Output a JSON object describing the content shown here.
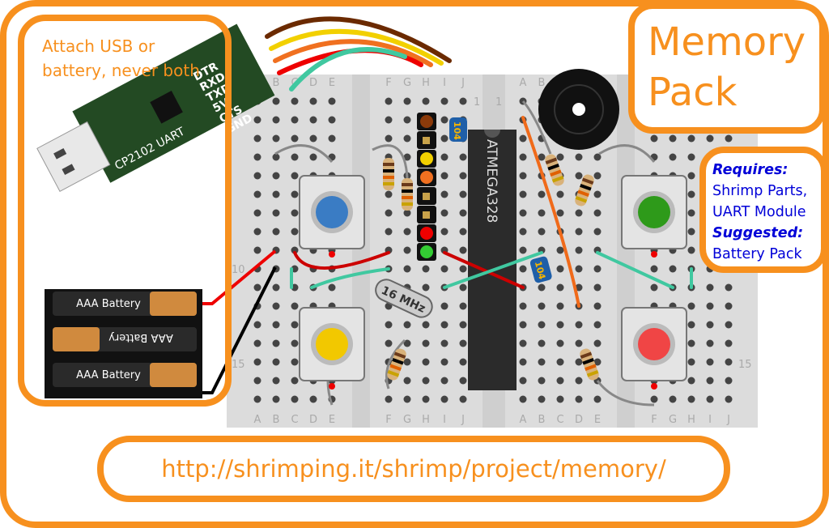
{
  "note": {
    "text": "Attach USB or battery, never both"
  },
  "title": {
    "line1": "Memory",
    "line2": "Pack"
  },
  "requirements": {
    "requires_label": "Requires:",
    "requires_items": [
      "Shrimp Parts,",
      "UART Module"
    ],
    "suggested_label": "Suggested:",
    "suggested_items": [
      "Battery Pack"
    ]
  },
  "url": "http://shrimping.it/shrimp/project/memory/",
  "uart": {
    "label": "CP2102 UART",
    "pins": [
      "DTR",
      "RXD",
      "TXD",
      "5V",
      "CTS",
      "GND"
    ]
  },
  "batteries": {
    "labels": [
      "AAA Battery",
      "AAA Battery",
      "AAA Battery"
    ]
  },
  "breadboard": {
    "column_letters_left": [
      "A",
      "B",
      "C",
      "D",
      "E",
      "F",
      "G",
      "H",
      "I",
      "J"
    ],
    "column_letters_right": [
      "A",
      "B",
      "C",
      "D",
      "E",
      "F",
      "G",
      "H",
      "I",
      "J"
    ],
    "row_labels": [
      "1",
      "10",
      "15"
    ]
  },
  "chip": {
    "label": "ATMEGA328"
  },
  "crystal": {
    "label": "16 MHz"
  },
  "capacitor": {
    "label": "104"
  },
  "leds": {
    "colors": {
      "blue": "#3a7cc4",
      "green": "#2e9a1a",
      "yellow": "#f2c800",
      "red": "#f04545"
    }
  },
  "colors": {
    "accent": "#f7901e",
    "text_blue": "#0000d8"
  }
}
